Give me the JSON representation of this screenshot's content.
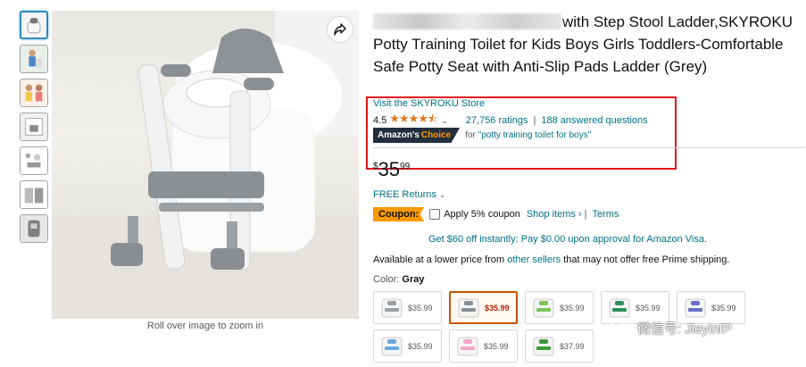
{
  "product": {
    "title_visible": "with Step Stool Ladder,SKYROKU Potty Training Toilet for Kids Boys Girls Toddlers-Comfortable Safe Potty Seat with Anti-Slip Pads Ladder (Grey)",
    "store_link": "Visit the SKYROKU Store",
    "rating_value": "4.5",
    "stars": "★★★★⯪",
    "ratings_count": "27,756 ratings",
    "answered_questions": "188 answered questions",
    "choice_badge_main": "Amazon's",
    "choice_badge_accent": "Choice",
    "choice_for": "for ",
    "choice_query": "\"potty training toilet for boys\"",
    "price_symbol": "$",
    "price_whole": "35",
    "price_fraction": "99",
    "free_returns": "FREE Returns",
    "coupon_tag": "Coupon:",
    "coupon_text": "Apply 5% coupon",
    "shop_items": "Shop items ›",
    "terms": "Terms",
    "promo": "Get $60 off instantly: Pay $0.00 upon approval for Amazon Visa.",
    "lower_price_prefix": "Available at a lower price from ",
    "lower_price_link": "other sellers",
    "lower_price_suffix": " that may not offer free Prime shipping.",
    "color_label": "Color: ",
    "color_value": "Gray"
  },
  "gallery": {
    "zoom_caption": "Roll over image to zoom in",
    "thumbnail_count": 7,
    "share_icon": "share-icon"
  },
  "swatches": [
    {
      "price": "$35.99",
      "color": "#9aa0a6",
      "selected": false
    },
    {
      "price": "$35.99",
      "color": "#8a8f94",
      "selected": true
    },
    {
      "price": "$35.99",
      "color": "#7cc35a",
      "selected": false
    },
    {
      "price": "$35.99",
      "color": "#2f8f5a",
      "selected": false
    },
    {
      "price": "$35.99",
      "color": "#6b6fc9",
      "selected": false
    },
    {
      "price": "$35.99",
      "color": "#6aa9e0",
      "selected": false
    },
    {
      "price": "$35.99",
      "color": "#f0a8c8",
      "selected": false
    },
    {
      "price": "$37.99",
      "color": "#3c9a3c",
      "selected": false
    }
  ],
  "watermark": {
    "text": "微信号: JieyinIP"
  },
  "colors": {
    "link": "#007185",
    "star": "#de7921",
    "coupon": "#ff9900",
    "badge": "#232f3e",
    "highlight_box": "#e0161d",
    "selected_swatch": "#c45500"
  }
}
